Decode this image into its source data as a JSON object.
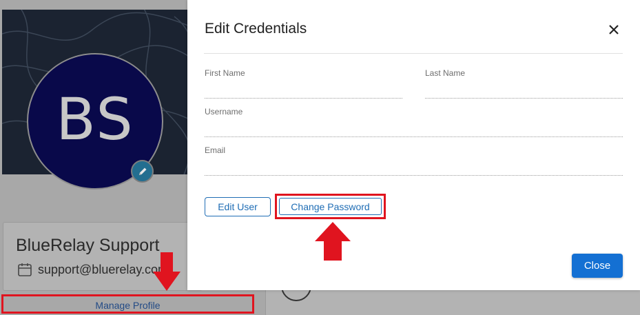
{
  "background": {
    "avatar_initials": "BS",
    "profile_name": "BlueRelay Support",
    "profile_email": "support@bluerelay.com",
    "manage_profile_label": "Manage Profile"
  },
  "modal": {
    "title": "Edit Credentials",
    "close_icon": "close-icon",
    "fields": {
      "first_name": {
        "label": "First Name",
        "value": "",
        "placeholder": ""
      },
      "last_name": {
        "label": "Last Name",
        "value": "",
        "placeholder": ""
      },
      "username": {
        "label": "Username",
        "value": "",
        "placeholder": ""
      },
      "email": {
        "label": "Email",
        "value": "",
        "placeholder": ""
      }
    },
    "edit_user_label": "Edit User",
    "change_password_label": "Change Password",
    "close_label": "Close"
  },
  "colors": {
    "accent": "#1470d3",
    "highlight": "#e0141f",
    "avatar_bg": "#09094a"
  }
}
